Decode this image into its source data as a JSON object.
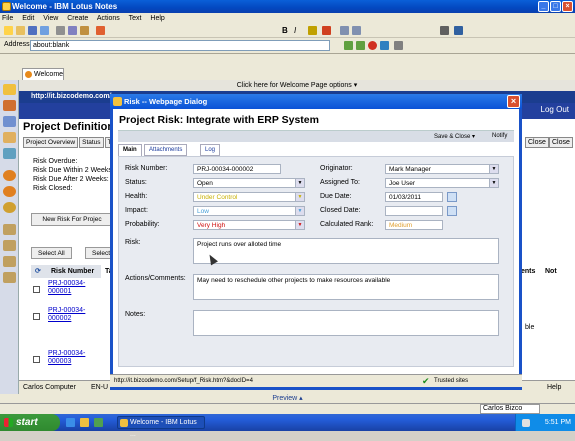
{
  "window": {
    "title": "Welcome - IBM Lotus Notes"
  },
  "menu": [
    "File",
    "Edit",
    "View",
    "Create",
    "Actions",
    "Text",
    "Help"
  ],
  "address": {
    "label": "Address",
    "value": "about:blank"
  },
  "tab": {
    "label": "Welcome"
  },
  "welcome_strip": "Click here for Welcome Page options ▾",
  "inner": {
    "url": "http://it.bizcodemo.com/",
    "logout": "Log Out",
    "project_title": "Project Definition:",
    "subtabs": [
      "Project Overview",
      "Status",
      "Te"
    ],
    "risk_counts": [
      "Risk Overdue:",
      "Risk Due Within 2 Weeks:",
      "Risk Due After 2 Weeks:",
      "Risk Closed:"
    ],
    "new_risk": "New Risk For Projec",
    "select_all": "Select All",
    "select2": "Select",
    "grid_col": "Risk Number",
    "grid_col_ta": "Ta",
    "risk_rows": [
      {
        "l1": "PRJ-00034-",
        "l2": "000001"
      },
      {
        "l1": "PRJ-00034-",
        "l2": "000002"
      },
      {
        "l1": "PRJ-00034-",
        "l2": "000003"
      }
    ],
    "right_buttons": [
      "Close",
      "Close"
    ],
    "right_col_text": [
      "ents",
      "Not",
      "ble"
    ],
    "status_user": "Carlos Computer",
    "status_locale": "EN-U",
    "help": "Help"
  },
  "dialog": {
    "title": "Risk -- Webpage Dialog",
    "heading": "Project Risk: Integrate with ERP System",
    "save_close": "Save & Close ▾",
    "notify": "Notify",
    "tabs": [
      "Main",
      "Attachments (0)",
      "Log"
    ],
    "fields": {
      "risk_number_label": "Risk Number:",
      "risk_number": "PRJ-00034-000002",
      "status_label": "Status:",
      "status": "Open",
      "health_label": "Health:",
      "health": "Under Control",
      "impact_label": "Impact:",
      "impact": "Low",
      "probability_label": "Probability:",
      "probability": "Very High",
      "originator_label": "Originator:",
      "originator": "Mark Manager",
      "assigned_label": "Assigned To:",
      "assigned": "Joe User",
      "due_label": "Due Date:",
      "due": "01/03/2011",
      "closed_label": "Closed Date:",
      "closed": "",
      "rank_label": "Calculated Rank:",
      "rank": "Medium",
      "risk_label": "Risk:",
      "risk": "Project runs over alloted time",
      "actions_label": "Actions/Comments:",
      "actions": "May need to reschedule other projects to make resources available",
      "notes_label": "Notes:",
      "notes": ""
    },
    "status_url": "http://it.bizcodemo.com/Setup/f_Risk.htm?&docID=4",
    "trusted": "Trusted sites"
  },
  "preview": "Preview ▴",
  "lotus_status": {
    "server": "Carlos Bizco"
  },
  "taskbar": {
    "start": "start",
    "item": "Welcome - IBM Lotus ...",
    "time": "5:51 PM"
  },
  "colors": {
    "health": "#c8b000",
    "impact": "#4aa0d8",
    "probability": "#d01010",
    "rank": "#e0a030"
  }
}
